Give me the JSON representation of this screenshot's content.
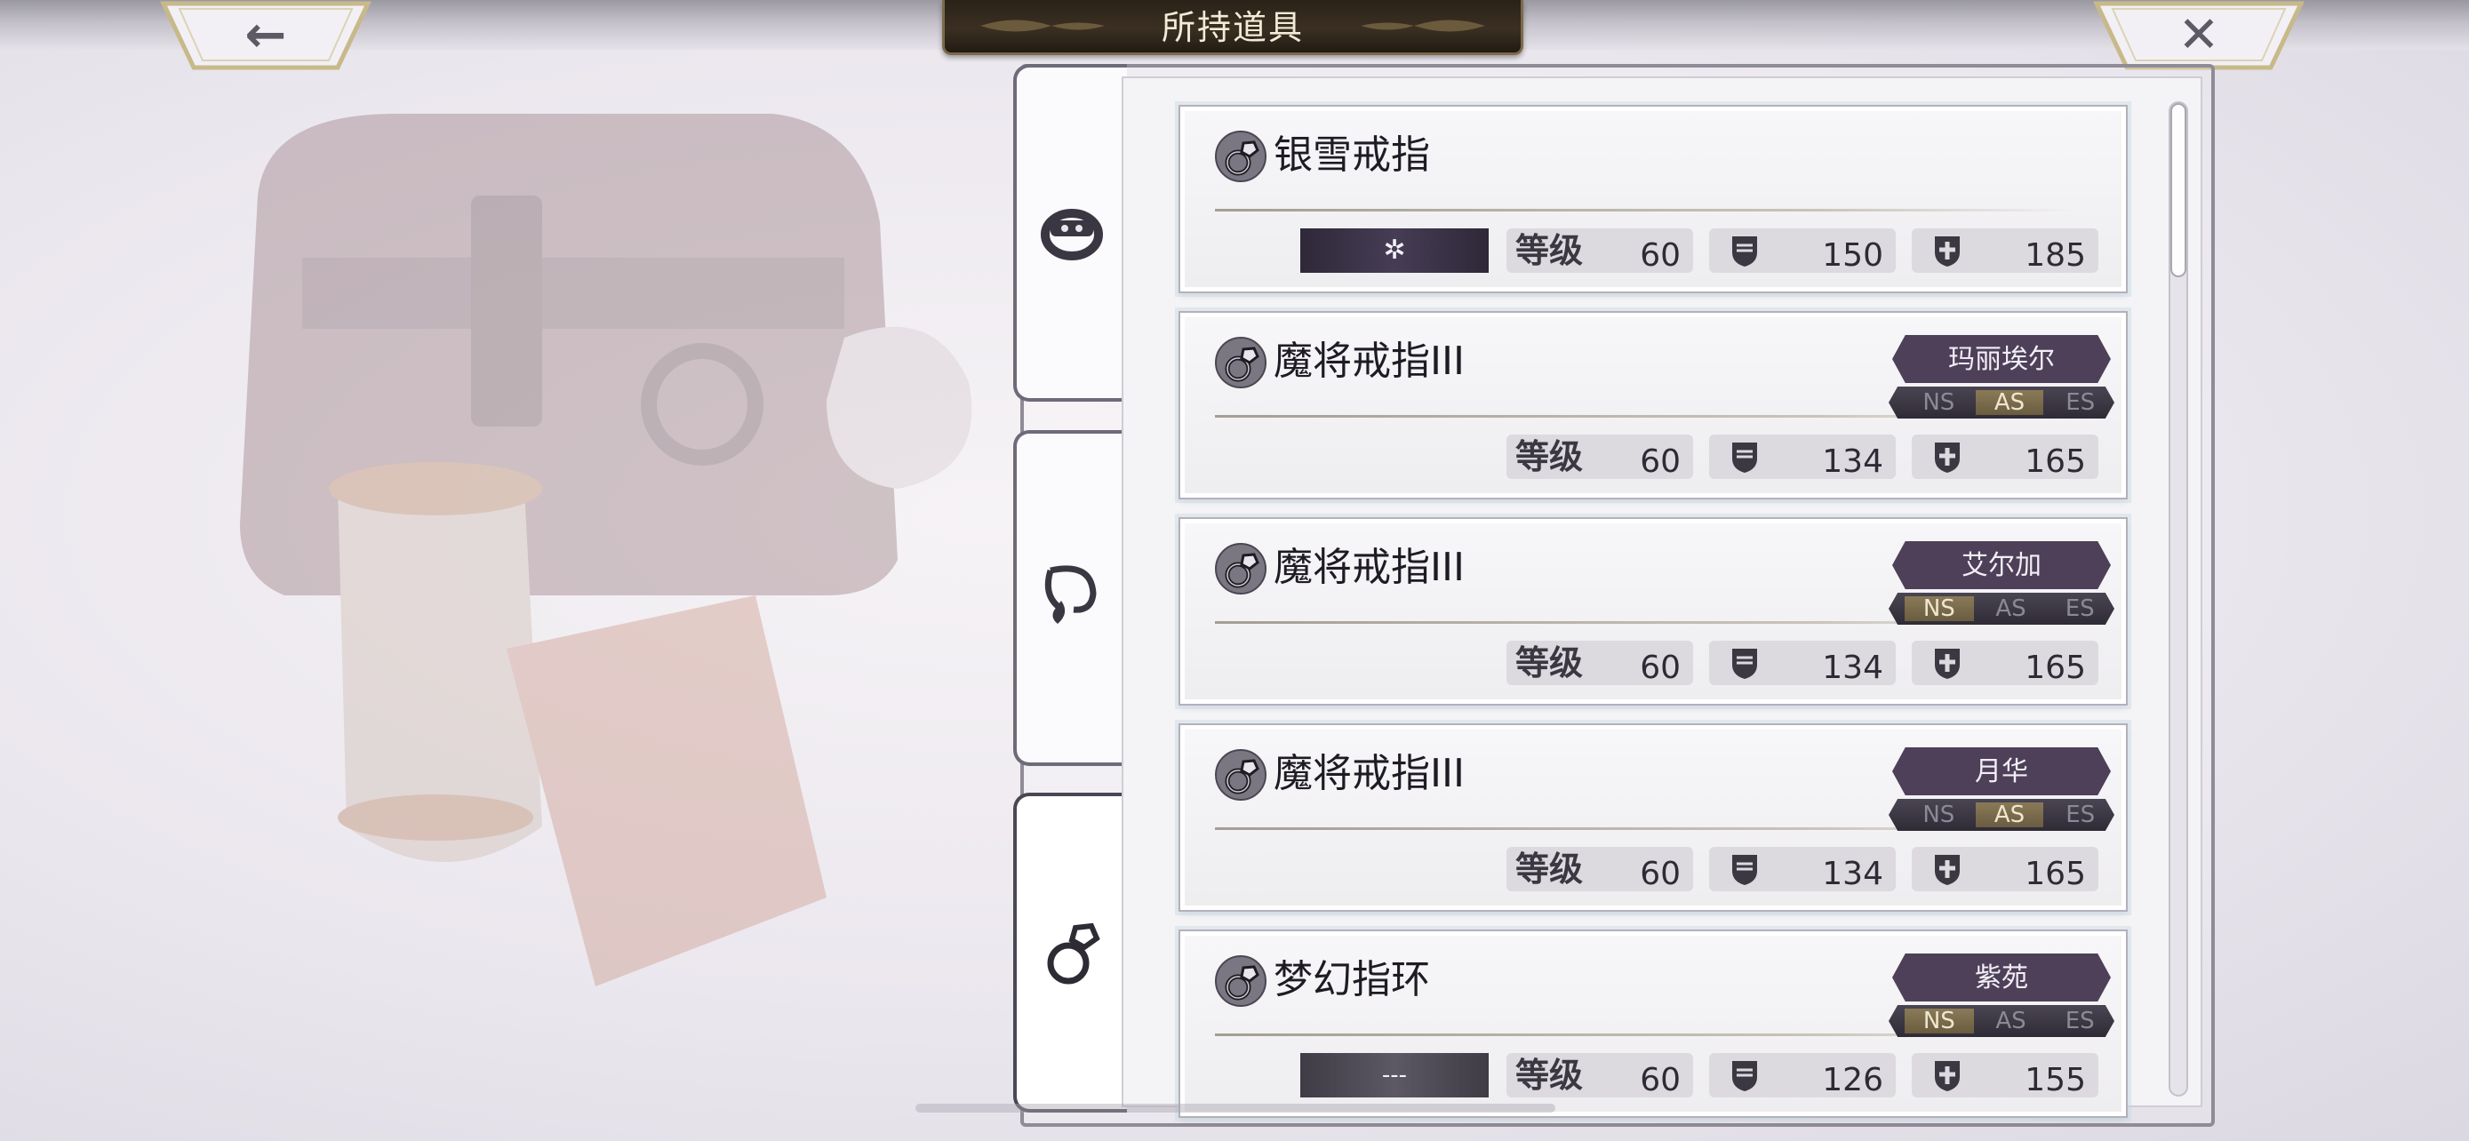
{
  "header": {
    "title": "所持道具",
    "back_icon": "←",
    "close_icon": "✕"
  },
  "tabs": [
    {
      "name": "bracelet",
      "active": false
    },
    {
      "name": "necklace",
      "active": false
    },
    {
      "name": "ring",
      "active": true
    }
  ],
  "stat_labels": {
    "level": "等级"
  },
  "items": [
    {
      "name": "银雪戒指",
      "owner": "",
      "grades": [],
      "element": "✲",
      "level": "60",
      "atk": "150",
      "def": "185"
    },
    {
      "name": "魔将戒指III",
      "owner": "玛丽埃尔",
      "grades": [
        "NS",
        "AS",
        "ES"
      ],
      "active_grades": [
        false,
        true,
        false
      ],
      "element": "",
      "level": "60",
      "atk": "134",
      "def": "165"
    },
    {
      "name": "魔将戒指III",
      "owner": "艾尔加",
      "grades": [
        "NS",
        "AS",
        "ES"
      ],
      "active_grades": [
        true,
        false,
        false
      ],
      "element": "",
      "level": "60",
      "atk": "134",
      "def": "165"
    },
    {
      "name": "魔将戒指III",
      "owner": "月华",
      "grades": [
        "NS",
        "AS",
        "ES"
      ],
      "active_grades": [
        false,
        true,
        false
      ],
      "element": "",
      "level": "60",
      "atk": "134",
      "def": "165"
    },
    {
      "name": "梦幻指环",
      "owner": "紫苑",
      "grades": [
        "NS",
        "AS",
        "ES"
      ],
      "active_grades": [
        true,
        false,
        false
      ],
      "element": "---",
      "level": "60",
      "atk": "126",
      "def": "155"
    }
  ],
  "colors": {
    "accent_dark": "#4d4058",
    "title_plate": "#2a2218",
    "grade_active": "#8a7a58"
  }
}
